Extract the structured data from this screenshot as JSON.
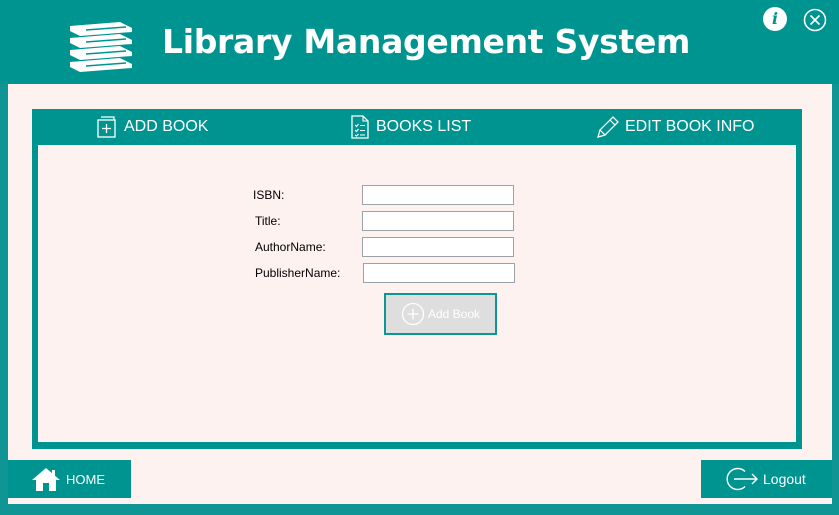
{
  "header": {
    "title": "Library Management System",
    "info_glyph": "i",
    "logo_icon": "books-stack-icon",
    "info_icon": "info-icon",
    "close_icon": "close-circle-icon"
  },
  "tabs": [
    {
      "label": "ADD BOOK",
      "icon": "add-page-icon"
    },
    {
      "label": "BOOKS LIST",
      "icon": "checklist-icon"
    },
    {
      "label": "EDIT BOOK INFO",
      "icon": "pencil-icon"
    }
  ],
  "form": {
    "isbn_label": "ISBN:",
    "title_label": "Title:",
    "author_label": "AuthorName:",
    "publisher_label": "PublisherName:",
    "isbn_value": "",
    "title_value": "",
    "author_value": "",
    "publisher_value": "",
    "submit_label": "Add Book"
  },
  "footer": {
    "home_label": "HOME",
    "logout_label": "Logout"
  },
  "colors": {
    "accent": "#009491",
    "background": "#fdf2f0",
    "button_disabled": "#dedede"
  }
}
